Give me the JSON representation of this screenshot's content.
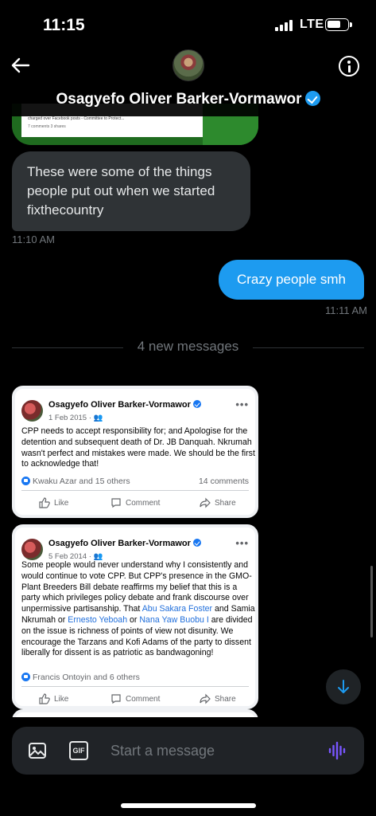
{
  "status_bar": {
    "time": "11:15",
    "network": "LTE",
    "battery_level": 0.65,
    "signal_bars": 4
  },
  "header": {
    "name": "Osagyefo Oliver Barker-Vormawor",
    "verified": true,
    "icons": [
      "back-arrow-icon",
      "info-icon"
    ]
  },
  "shared_media": {
    "caption_fragment": "charged over Facebook posts - Committee to Protect...",
    "meta": "7 comments 3 shares"
  },
  "messages": [
    {
      "direction": "incoming",
      "text": "These were some of the things people put out when we started fixthecountry",
      "timestamp": "11:10 AM"
    },
    {
      "direction": "outgoing",
      "text": "Crazy people smh",
      "timestamp": "11:11 AM"
    }
  ],
  "divider": {
    "label": "4 new messages"
  },
  "posts": [
    {
      "author": "Osagyefo Oliver Barker-Vormawor",
      "date": "1 Feb 2015 · ",
      "text": "CPP needs to accept responsibility for; and Apologise for the detention and subsequent death of Dr. JB Danquah. Nkrumah wasn't perfect and mistakes were made. We should be the first to acknowledge that!",
      "reactions": "Kwaku Azar and 15 others",
      "comments": "14 comments",
      "actions": {
        "like": "Like",
        "comment": "Comment",
        "share": "Share"
      }
    },
    {
      "author": "Osagyefo Oliver Barker-Vormawor",
      "date": "5 Feb 2014 · ",
      "text_part1": "Some people would never understand why I consistently and would continue to vote CPP. But CPP's presence in the GMO- Plant Breeders Bill debate reaffirms my belief that this is a party which privileges policy debate and frank discourse over unpermissive partisanship. That ",
      "link1": "Abu Sakara Foster",
      "text_part2": " and Samia Nkrumah or ",
      "link2": "Ernesto Yeboah",
      "text_part3": " or ",
      "link3": "Nana Yaw Buobu I",
      "text_part4": " are divided on the issue is richness of points of view not disunity. We encourage the Tarzans and Kofi Adams of the party to dissent liberally for dissent is as patriotic as bandwagoning!",
      "reactions": "Francis Ontoyin and 6 others",
      "actions": {
        "like": "Like",
        "comment": "Comment",
        "share": "Share"
      }
    }
  ],
  "composer": {
    "placeholder": "Start a message",
    "gif_label": "GIF"
  },
  "colors": {
    "accent": "#1d9bf0",
    "incoming_bubble": "#2f3336",
    "voice_accent": "#7856ff",
    "facebook_link": "#216fdb"
  }
}
